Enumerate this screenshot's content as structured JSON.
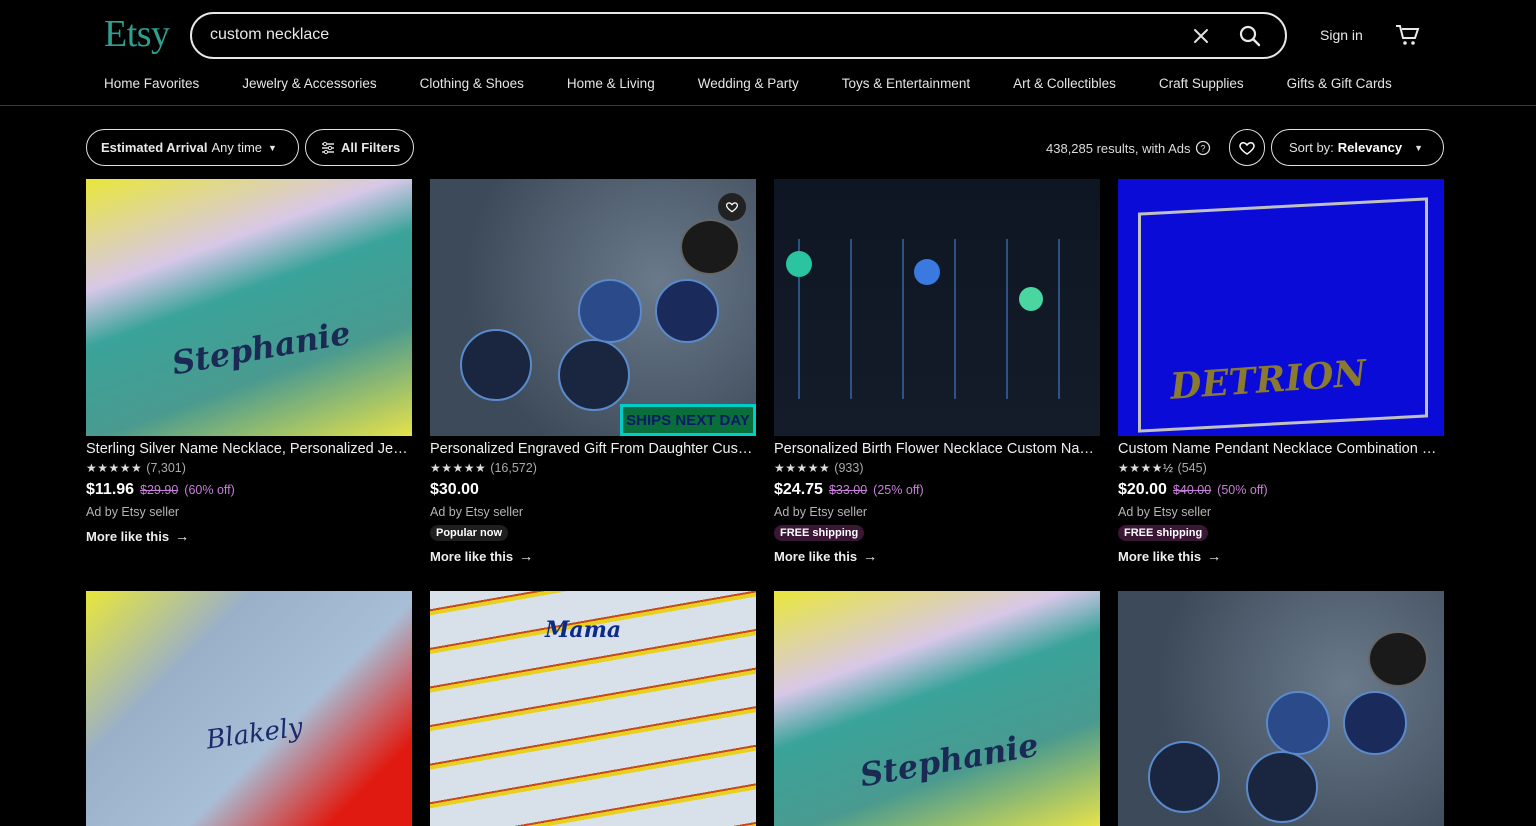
{
  "header": {
    "logo": "Etsy",
    "search_value": "custom necklace",
    "signin": "Sign in"
  },
  "categories": [
    "Home Favorites",
    "Jewelry & Accessories",
    "Clothing & Shoes",
    "Home & Living",
    "Wedding & Party",
    "Toys & Entertainment",
    "Art & Collectibles",
    "Craft Supplies",
    "Gifts & Gift Cards"
  ],
  "toolbar": {
    "est_label": "Estimated Arrival",
    "est_value": "Any time",
    "filters": "All Filters",
    "results": "438,285 results, with Ads",
    "sort_label": "Sort by:",
    "sort_value": "Relevancy"
  },
  "listings": [
    {
      "title": "Sterling Silver Name Necklace, Personalized Jewelry, Name Necklace",
      "stars": "★★★★★",
      "reviews": "(7,301)",
      "price": "$11.96",
      "old_price": "$29.90",
      "discount": "(60% off)",
      "ad": "Ad by Etsy seller",
      "badge": "",
      "more": "More like this",
      "img_word": "Stephanie"
    },
    {
      "title": "Personalized Engraved Gift From Daughter Custom Necklace",
      "stars": "★★★★★",
      "reviews": "(16,572)",
      "price": "$30.00",
      "old_price": "",
      "discount": "",
      "ad": "Ad by Etsy seller",
      "badge": "Popular now",
      "more": "More like this",
      "ships": "SHIPS NEXT DAY"
    },
    {
      "title": "Personalized Birth Flower Necklace Custom Name Necklace",
      "stars": "★★★★★",
      "reviews": "(933)",
      "price": "$24.75",
      "old_price": "$33.00",
      "discount": "(25% off)",
      "ad": "Ad by Etsy seller",
      "badge": "FREE shipping",
      "more": "More like this"
    },
    {
      "title": "Custom Name Pendant Necklace Combination Chain",
      "stars": "★★★★½",
      "reviews": "(545)",
      "price": "$20.00",
      "old_price": "$40.00",
      "discount": "(50% off)",
      "ad": "Ad by Etsy seller",
      "badge": "FREE shipping",
      "more": "More like this",
      "img_word": "DETRION"
    }
  ],
  "row2_words": [
    "Blakely",
    "Mama",
    "Stephanie",
    ""
  ],
  "colors": {
    "logo": "#2f9f8f",
    "discount": "#c77fd9",
    "ships_green": "#0a6e3a"
  }
}
